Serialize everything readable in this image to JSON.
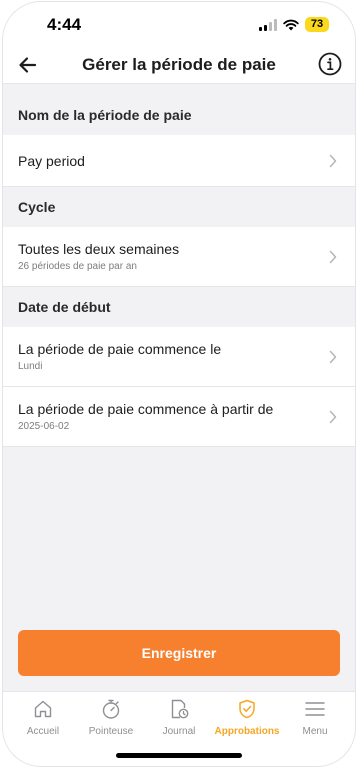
{
  "status_bar": {
    "time": "4:44",
    "battery": "73"
  },
  "header": {
    "title": "Gérer la période de paie",
    "back_icon": "arrow-left-icon",
    "info_icon": "info-circle-icon"
  },
  "sections": [
    {
      "header": "Nom de la période de paie",
      "rows": [
        {
          "title": "Pay period",
          "subtitle": ""
        }
      ]
    },
    {
      "header": "Cycle",
      "rows": [
        {
          "title": "Toutes les deux semaines",
          "subtitle": "26 périodes de paie par an"
        }
      ]
    },
    {
      "header": "Date de début",
      "rows": [
        {
          "title": "La période de paie commence le",
          "subtitle": "Lundi"
        },
        {
          "title": "La période de paie commence à partir de",
          "subtitle": "2025-06-02"
        }
      ]
    }
  ],
  "save_button": {
    "label": "Enregistrer"
  },
  "tab_bar": {
    "items": [
      {
        "label": "Accueil",
        "icon": "home-icon",
        "active": false
      },
      {
        "label": "Pointeuse",
        "icon": "stopwatch-icon",
        "active": false
      },
      {
        "label": "Journal",
        "icon": "journal-clock-icon",
        "active": false
      },
      {
        "label": "Approbations",
        "icon": "shield-check-icon",
        "active": true
      },
      {
        "label": "Menu",
        "icon": "hamburger-menu-icon",
        "active": false
      }
    ]
  },
  "colors": {
    "accent": "#F6802E",
    "active_tab": "#F5A623",
    "battery": "#F9D81E"
  }
}
